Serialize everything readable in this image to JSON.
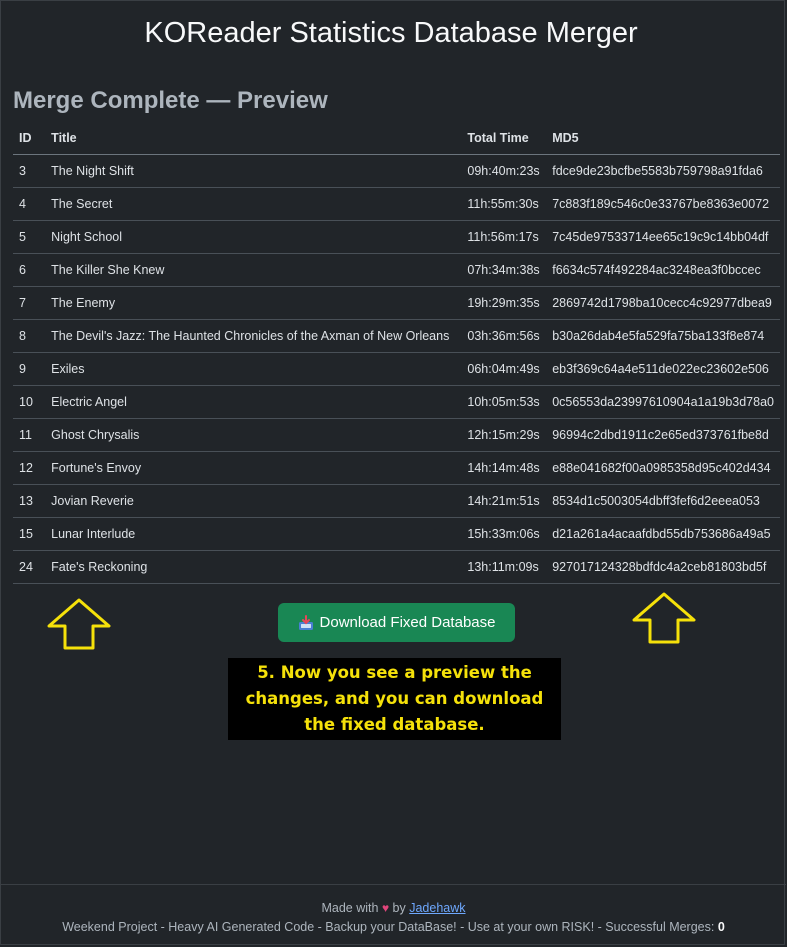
{
  "app": {
    "title": "KOReader Statistics Database Merger"
  },
  "section": {
    "title": "Merge Complete — Preview"
  },
  "table": {
    "columns": [
      "ID",
      "Title",
      "Total Time",
      "MD5"
    ],
    "rows": [
      {
        "id": "3",
        "title": "The Night Shift",
        "total_time": "09h:40m:23s",
        "md5": "fdce9de23bcfbe5583b759798a91fda6"
      },
      {
        "id": "4",
        "title": "The Secret",
        "total_time": "11h:55m:30s",
        "md5": "7c883f189c546c0e33767be8363e0072"
      },
      {
        "id": "5",
        "title": "Night School",
        "total_time": "11h:56m:17s",
        "md5": "7c45de97533714ee65c19c9c14bb04df"
      },
      {
        "id": "6",
        "title": "The Killer She Knew",
        "total_time": "07h:34m:38s",
        "md5": "f6634c574f492284ac3248ea3f0bccec"
      },
      {
        "id": "7",
        "title": "The Enemy",
        "total_time": "19h:29m:35s",
        "md5": "2869742d1798ba10cecc4c92977dbea9"
      },
      {
        "id": "8",
        "title": "The Devil's Jazz: The Haunted Chronicles of the Axman of New Orleans",
        "total_time": "03h:36m:56s",
        "md5": "b30a26dab4e5fa529fa75ba133f8e874"
      },
      {
        "id": "9",
        "title": "Exiles",
        "total_time": "06h:04m:49s",
        "md5": "eb3f369c64a4e511de022ec23602e506"
      },
      {
        "id": "10",
        "title": "Electric Angel",
        "total_time": "10h:05m:53s",
        "md5": "0c56553da23997610904a1a19b3d78a0"
      },
      {
        "id": "11",
        "title": "Ghost Chrysalis",
        "total_time": "12h:15m:29s",
        "md5": "96994c2dbd1911c2e65ed373761fbe8d"
      },
      {
        "id": "12",
        "title": "Fortune's Envoy",
        "total_time": "14h:14m:48s",
        "md5": "e88e041682f00a0985358d95c402d434"
      },
      {
        "id": "13",
        "title": "Jovian Reverie",
        "total_time": "14h:21m:51s",
        "md5": "8534d1c5003054dbff3fef6d2eeea053"
      },
      {
        "id": "15",
        "title": "Lunar Interlude",
        "total_time": "15h:33m:06s",
        "md5": "d21a261a4acaafdbd55db753686a49a5"
      },
      {
        "id": "24",
        "title": "Fate's Reckoning",
        "total_time": "13h:11m:09s",
        "md5": "927017124328bdfdc4a2ceb81803bd5f"
      }
    ]
  },
  "download": {
    "label": "Download Fixed Database",
    "icon": "inbox-tray-icon",
    "color": "#198754"
  },
  "callout": {
    "text": "5. Now you see a preview the changes, and you can download the fixed database.",
    "color": "#f5e10a"
  },
  "footer": {
    "made_with": "Made with",
    "heart": "♥",
    "by": "by",
    "author": "Jadehawk",
    "notice": "Weekend Project - Heavy AI Generated Code - Backup your DataBase! - Use at your own RISK! - Successful Merges:",
    "merge_count": "0"
  }
}
